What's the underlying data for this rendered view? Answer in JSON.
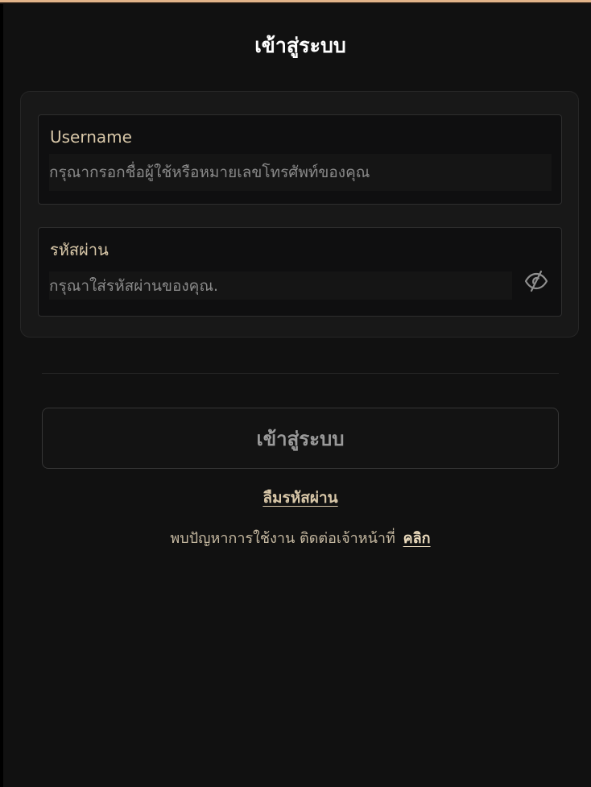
{
  "page": {
    "title": "เข้าสู่ระบบ",
    "accent_color": "#e2b48a",
    "background_color": "#111111"
  },
  "form": {
    "username": {
      "label": "Username",
      "placeholder": "กรุณากรอกชื่อผู้ใช้หรือหมายเลขโทรศัพท์ของคุณ",
      "value": ""
    },
    "password": {
      "label": "รหัสผ่าน",
      "placeholder": "กรุณาใส่รหัสผ่านของคุณ.",
      "value": "",
      "toggle_icon": "eye-off-icon"
    }
  },
  "actions": {
    "login_label": "เข้าสู่ระบบ",
    "forgot_password_label": "ลืมรหัสผ่าน",
    "help_text": "พบปัญหาการใช้งาน ติดต่อเจ้าหน้าที่",
    "help_link_label": "คลิก"
  }
}
